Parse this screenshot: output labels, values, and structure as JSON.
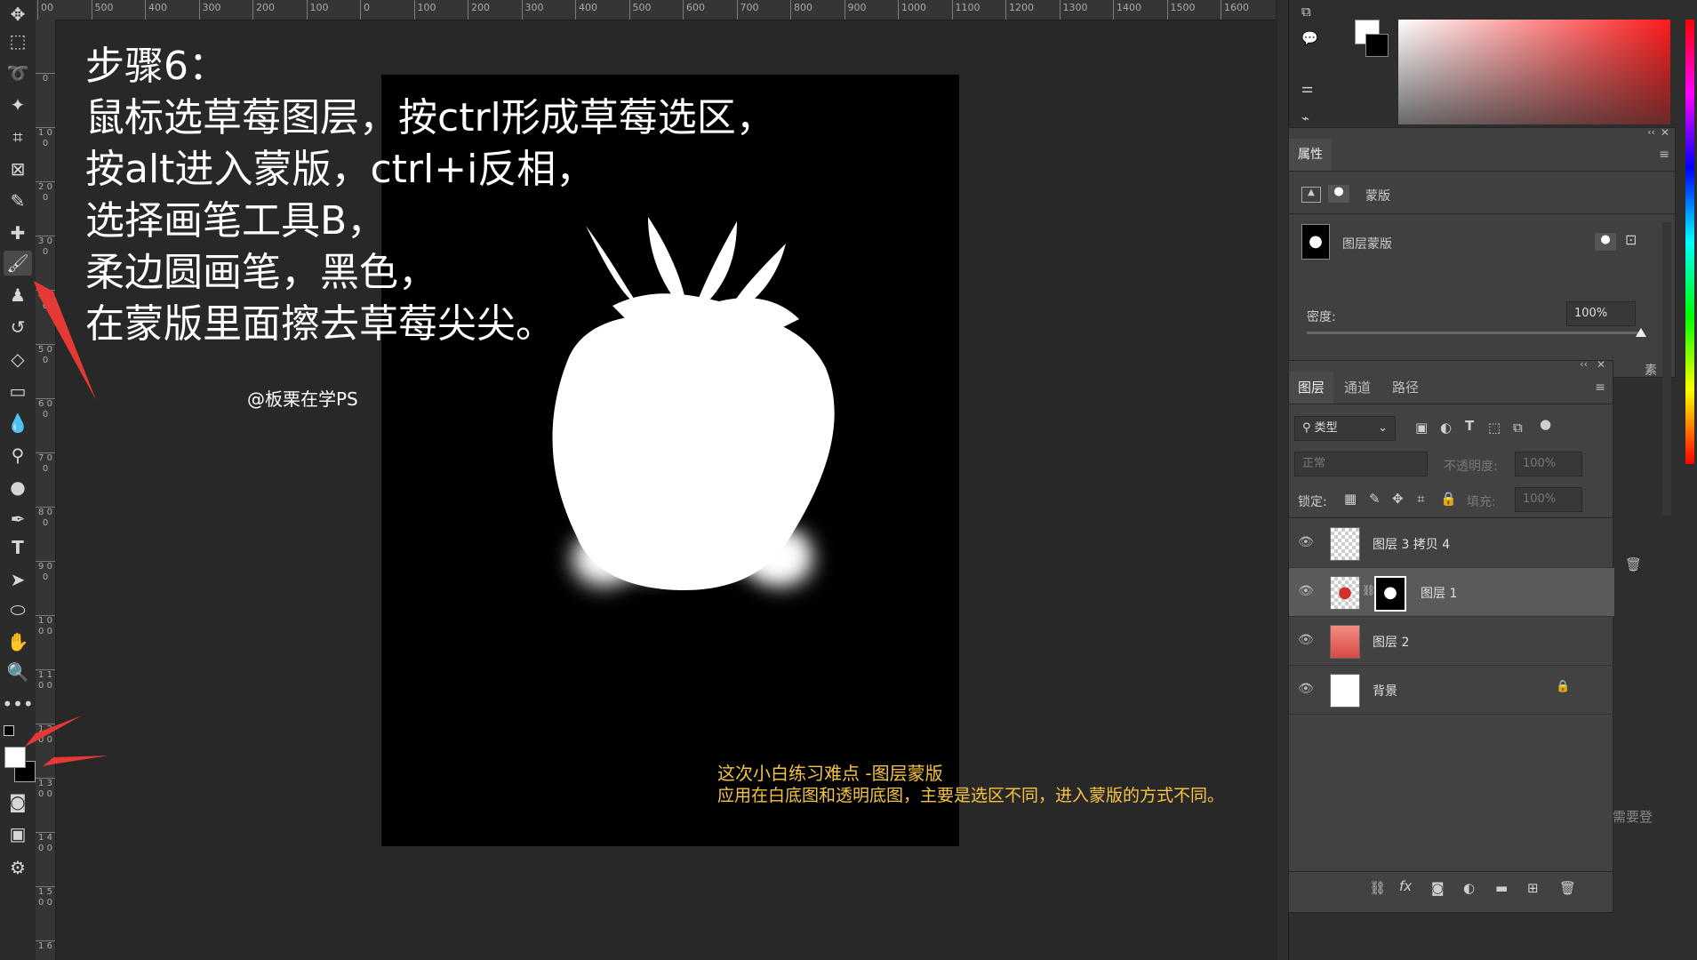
{
  "ruler_top": [
    "00",
    "500",
    "400",
    "300",
    "200",
    "100",
    "0",
    "100",
    "200",
    "300",
    "400",
    "500",
    "600",
    "700",
    "800",
    "900",
    "1000",
    "1100",
    "1200",
    "1300",
    "1400",
    "1500",
    "1600"
  ],
  "ruler_left": [
    "0",
    "1 0 0",
    "2 0 0",
    "3 0 0",
    "4 0 0",
    "5 0 0",
    "6 0 0",
    "7 0 0",
    "8 0 0",
    "9 0 0",
    "1 0 0 0",
    "1 1 0 0",
    "1 2 0 0",
    "1 3 0 0",
    "1 4 0 0",
    "1 5 0 0",
    "1 6"
  ],
  "tutorial": {
    "lines": [
      "步骤6：",
      "鼠标选草莓图层，按ctrl形成草莓选区，",
      "按alt进入蒙版，ctrl+i反相，",
      "选择画笔工具B，",
      "柔边圆画笔，黑色，",
      "在蒙版里面擦去草莓尖尖。"
    ],
    "watermark": "@板栗在学PS",
    "note_line1": "这次小白练习难点 -图层蒙版",
    "note_line2": "应用在白底图和透明底图，主要是选区不同，进入蒙版的方式不同。"
  },
  "properties": {
    "tab": "属性",
    "type_label": "蒙版",
    "mask_label": "图层蒙版",
    "density_label": "密度:",
    "density_value": "100%",
    "partial_text": "素",
    "partial_text2": "需要登"
  },
  "layers_panel": {
    "tabs": [
      "图层",
      "通道",
      "路径"
    ],
    "filter_kind": "类型",
    "blend_mode": "正常",
    "opacity_label": "不透明度:",
    "opacity_value": "100%",
    "lock_label": "锁定:",
    "fill_label": "填充:",
    "fill_value": "100%",
    "layers": [
      {
        "name": "图层 3 拷贝 4"
      },
      {
        "name": "图层 1"
      },
      {
        "name": "图层 2"
      },
      {
        "name": "背景"
      }
    ],
    "footer_fx": "fx"
  },
  "colors": {
    "accent_red": "#e53935",
    "note_yellow": "#f6c343",
    "canvas_bg": "#282828"
  }
}
